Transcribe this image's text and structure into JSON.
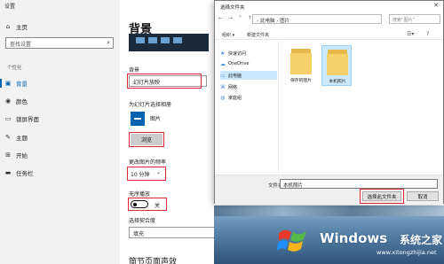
{
  "settings": {
    "window_title": "设置",
    "sidebar": {
      "home": "主页",
      "search_placeholder": "查找设置",
      "section": "个性化",
      "items": [
        {
          "label": "背景",
          "icon": "image-icon",
          "active": true
        },
        {
          "label": "颜色",
          "icon": "palette-icon",
          "active": false
        },
        {
          "label": "锁屏界面",
          "icon": "lock-screen-icon",
          "active": false
        },
        {
          "label": "主题",
          "icon": "theme-icon",
          "active": false
        },
        {
          "label": "开始",
          "icon": "start-icon",
          "active": false
        },
        {
          "label": "任务栏",
          "icon": "taskbar-icon",
          "active": false
        }
      ]
    },
    "main": {
      "title": "背景",
      "background_label": "背景",
      "background_value": "幻灯片放映",
      "album_label": "为幻灯片选择相册",
      "album_name": "图片",
      "browse_label": "浏览",
      "interval_label": "更改图片的频率",
      "interval_value": "10 分钟",
      "shuffle_label": "无序播放",
      "shuffle_state": "关",
      "fit_label": "选择契合度",
      "fit_value": "填充",
      "bottom_heading": "简节页面声效"
    }
  },
  "dialog": {
    "title": "选择文件夹",
    "breadcrumb": "› 此电脑 › 图片",
    "search_placeholder": "搜索“图片”",
    "toolbar": {
      "organize": "组织 ▾",
      "new_folder": "新建文件夹"
    },
    "nav": [
      {
        "label": "快速访问",
        "icon": "star-icon"
      },
      {
        "label": "OneDrive",
        "icon": "cloud-icon"
      },
      {
        "label": "此电脑",
        "icon": "computer-icon",
        "selected": true
      },
      {
        "label": "网络",
        "icon": "network-icon"
      },
      {
        "label": "家庭组",
        "icon": "homegroup-icon"
      }
    ],
    "folders": [
      {
        "name": "保存的图片",
        "selected": false
      },
      {
        "name": "本机照片",
        "selected": true
      }
    ],
    "folder_label": "文件夹:",
    "folder_value": "本机照片",
    "select_button": "选择此文件夹",
    "cancel_button": "取消"
  },
  "watermark": {
    "brand": "Windows",
    "site_name": "系统之家",
    "url": "www.xitongzhijia.net",
    "colors": {
      "logo_blue": "#1e90ff",
      "logo_red": "#e8392b",
      "logo_green": "#55b947",
      "logo_yellow": "#f6b41a"
    }
  },
  "colors": {
    "accent": "#0063b1",
    "highlight_red": "#e0283a"
  }
}
